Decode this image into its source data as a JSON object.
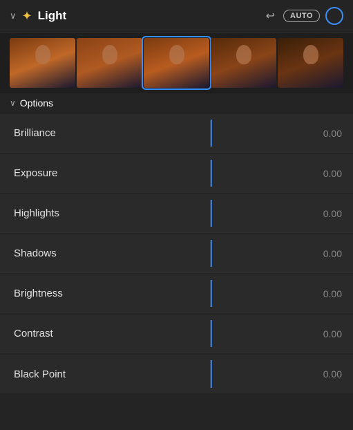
{
  "header": {
    "title": "Light",
    "auto_label": "AUTO",
    "sun_icon": "☀",
    "chevron": "⌄",
    "undo_icon": "↩"
  },
  "options": {
    "label": "Options",
    "chevron": "⌄"
  },
  "sliders": [
    {
      "label": "Brilliance",
      "value": "0.00"
    },
    {
      "label": "Exposure",
      "value": "0.00"
    },
    {
      "label": "Highlights",
      "value": "0.00"
    },
    {
      "label": "Shadows",
      "value": "0.00"
    },
    {
      "label": "Brightness",
      "value": "0.00"
    },
    {
      "label": "Contrast",
      "value": "0.00"
    },
    {
      "label": "Black Point",
      "value": "0.00"
    }
  ],
  "thumbnails": [
    {
      "selected": false
    },
    {
      "selected": false
    },
    {
      "selected": true
    },
    {
      "selected": false
    },
    {
      "selected": false
    }
  ]
}
